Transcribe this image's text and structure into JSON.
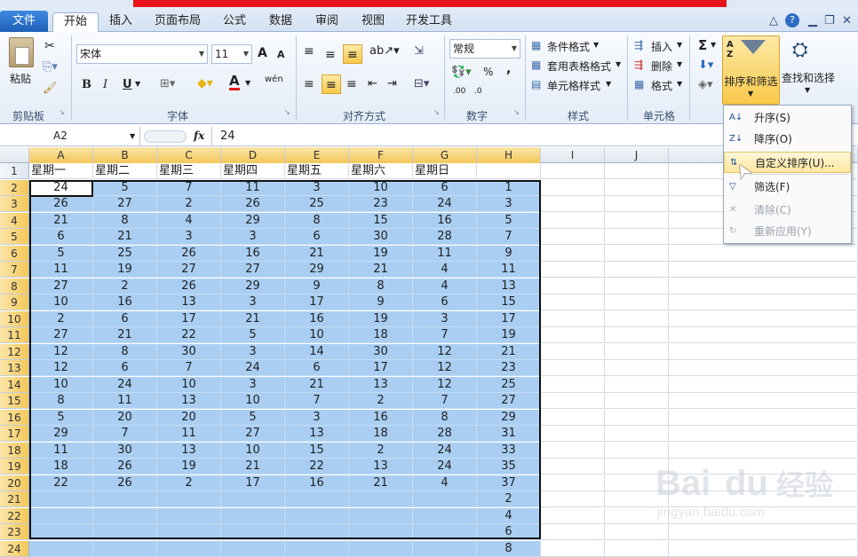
{
  "tabs": {
    "file": "文件",
    "items": [
      "开始",
      "插入",
      "页面布局",
      "公式",
      "数据",
      "审阅",
      "视图",
      "开发工具"
    ]
  },
  "ribbon": {
    "clipboard": {
      "paste": "粘贴",
      "label": "剪贴板"
    },
    "font": {
      "name": "宋体",
      "size": "11",
      "label": "字体",
      "bold": "B",
      "italic": "I",
      "underline": "U",
      "grow": "A",
      "shrink": "A",
      "font_color": "A",
      "phonetic": "wén"
    },
    "alignment": {
      "label": "对齐方式"
    },
    "number": {
      "format": "常规",
      "label": "数字",
      "percent": "%",
      "comma": ",",
      "inc_decimal": ".00",
      "dec_decimal": ".0"
    },
    "styles": {
      "conditional": "条件格式",
      "table": "套用表格格式",
      "cell": "单元格样式",
      "label": "样式"
    },
    "cells": {
      "insert": "插入",
      "delete": "删除",
      "format": "格式",
      "label": "单元格"
    },
    "editing": {
      "sigma": "Σ",
      "sort_filter": "排序和筛选",
      "find_select": "查找和选择"
    }
  },
  "formula_bar": {
    "name_box": "A2",
    "fx": "fx",
    "value": "24"
  },
  "columns": [
    "A",
    "B",
    "C",
    "D",
    "E",
    "F",
    "G",
    "H",
    "I",
    "J",
    "K"
  ],
  "header_row": [
    "星期一",
    "星期二",
    "星期三",
    "星期四",
    "星期五",
    "星期六",
    "星期日"
  ],
  "rows": [
    [
      24,
      5,
      7,
      11,
      3,
      10,
      6,
      1
    ],
    [
      26,
      27,
      2,
      26,
      25,
      23,
      24,
      3
    ],
    [
      21,
      8,
      4,
      29,
      8,
      15,
      16,
      5
    ],
    [
      6,
      21,
      3,
      3,
      6,
      30,
      28,
      7
    ],
    [
      5,
      25,
      26,
      16,
      21,
      19,
      11,
      9
    ],
    [
      11,
      19,
      27,
      27,
      29,
      21,
      4,
      11
    ],
    [
      27,
      2,
      26,
      29,
      9,
      8,
      4,
      13
    ],
    [
      10,
      16,
      13,
      3,
      17,
      9,
      6,
      15
    ],
    [
      2,
      6,
      17,
      21,
      16,
      19,
      3,
      17
    ],
    [
      27,
      21,
      22,
      5,
      10,
      18,
      7,
      19
    ],
    [
      12,
      8,
      30,
      3,
      14,
      30,
      12,
      21
    ],
    [
      12,
      6,
      7,
      24,
      6,
      17,
      12,
      23
    ],
    [
      10,
      24,
      10,
      3,
      21,
      13,
      12,
      25
    ],
    [
      8,
      11,
      13,
      10,
      7,
      2,
      7,
      27
    ],
    [
      5,
      20,
      20,
      5,
      3,
      16,
      8,
      29
    ],
    [
      29,
      7,
      11,
      27,
      13,
      18,
      28,
      31
    ],
    [
      11,
      30,
      13,
      10,
      15,
      2,
      24,
      33
    ],
    [
      18,
      26,
      19,
      21,
      22,
      13,
      24,
      35
    ],
    [
      22,
      26,
      2,
      17,
      16,
      21,
      4,
      37
    ],
    [
      "",
      "",
      "",
      "",
      "",
      "",
      "",
      2
    ],
    [
      "",
      "",
      "",
      "",
      "",
      "",
      "",
      4
    ],
    [
      "",
      "",
      "",
      "",
      "",
      "",
      "",
      6
    ],
    [
      "",
      "",
      "",
      "",
      "",
      "",
      "",
      8
    ]
  ],
  "row_numbers": [
    "1",
    "2",
    "3",
    "4",
    "5",
    "6",
    "7",
    "8",
    "9",
    "10",
    "11",
    "12",
    "13",
    "14",
    "15",
    "16",
    "17",
    "18",
    "19",
    "20",
    "21",
    "22",
    "23",
    "24"
  ],
  "sort_menu": {
    "items": [
      {
        "label": "升序(S)",
        "icon": "sort-ascending-icon",
        "enabled": true
      },
      {
        "label": "降序(O)",
        "icon": "sort-descending-icon",
        "enabled": true
      },
      {
        "label": "自定义排序(U)...",
        "icon": "custom-sort-icon",
        "enabled": true,
        "highlighted": true
      },
      {
        "label": "筛选(F)",
        "icon": "filter-icon",
        "enabled": true
      },
      {
        "label": "清除(C)",
        "icon": "clear-filter-icon",
        "enabled": false
      },
      {
        "label": "重新应用(Y)",
        "icon": "reapply-icon",
        "enabled": false
      }
    ]
  },
  "watermark": {
    "brand": "Bai",
    "brand2": "du",
    "cn": "经验",
    "url": "jingyan.baidu.com"
  },
  "colors": {
    "selection": "#a9cef2",
    "file_tab": "#2a6fcc",
    "highlight": "#f8c94a"
  }
}
